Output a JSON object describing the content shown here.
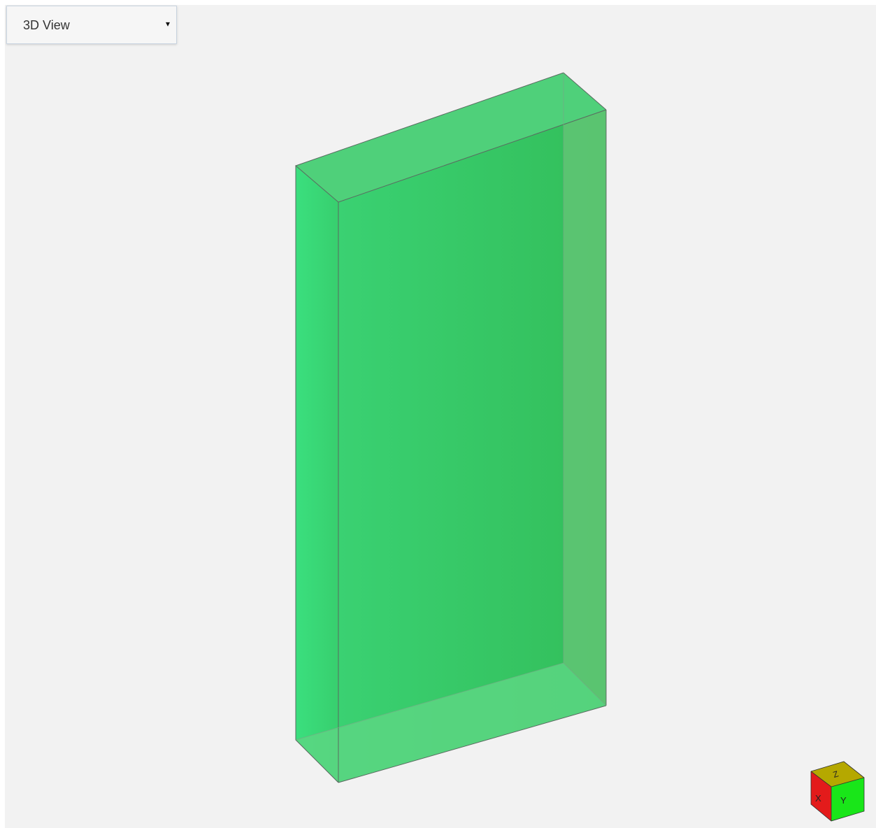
{
  "view_selector": {
    "selected": "3D View",
    "caret": "▾"
  },
  "model": {
    "color": "#36cd69"
  },
  "axis_cube": {
    "labels": {
      "x": "X",
      "y": "Y",
      "z": "Z"
    },
    "colors": {
      "x": "#e31b1b",
      "y": "#19e619",
      "z": "#b5a800"
    }
  },
  "colors": {
    "background": "#f2f2f2",
    "edge": "#5a6a60"
  }
}
